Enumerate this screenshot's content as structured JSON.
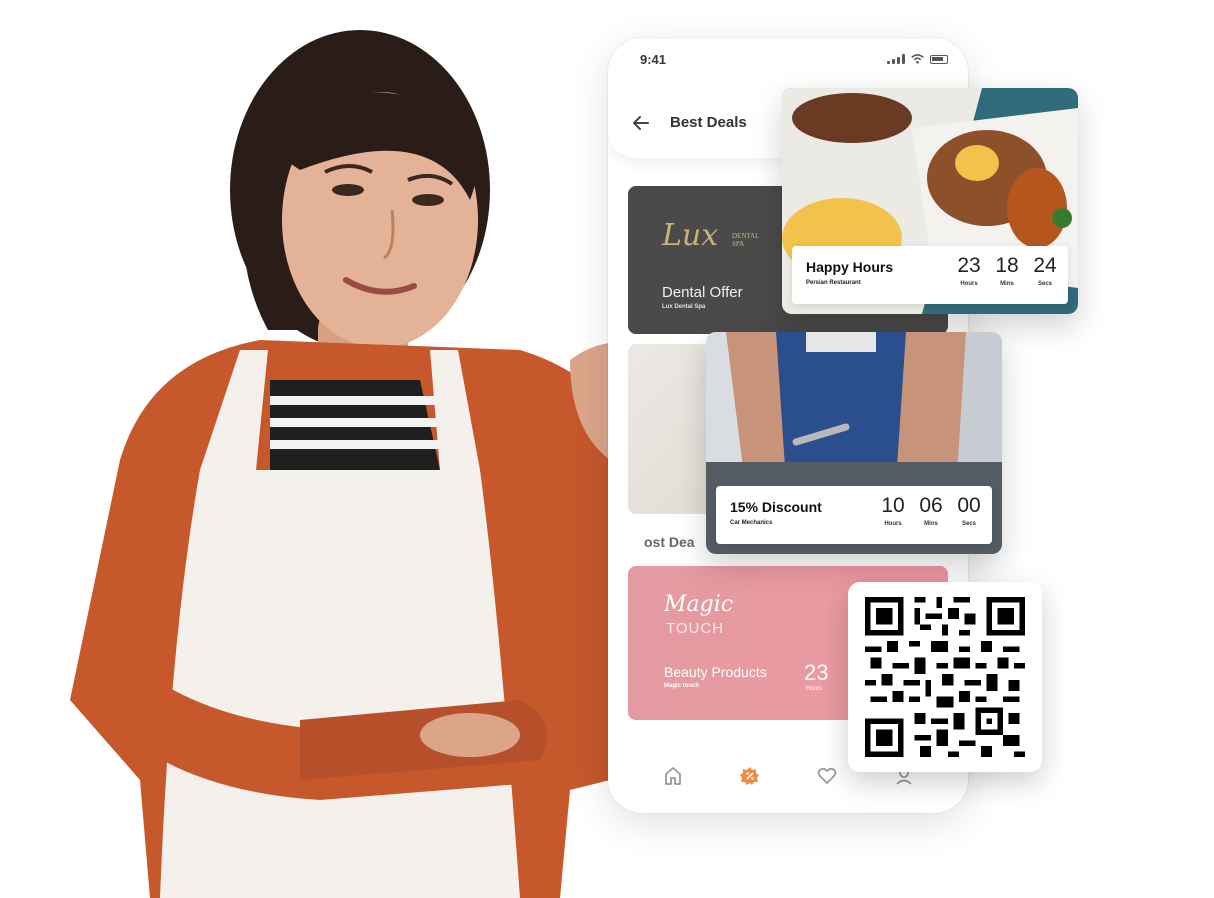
{
  "status_bar": {
    "time": "9:41"
  },
  "header": {
    "title": "Best Deals"
  },
  "dental_card": {
    "logo_script": "Lux",
    "logo_sub": "DENTAL SPA",
    "title": "Dental Offer",
    "subtitle": "Lux Dental Spa"
  },
  "section": {
    "label": "ost Dea"
  },
  "beauty_card": {
    "logo_script": "Magic",
    "logo_sub": "TOUCH",
    "title": "Beauty Products",
    "subtitle": "Magic touch",
    "hours": "23",
    "hours_label": "Hours"
  },
  "food_card": {
    "title": "Happy Hours",
    "subtitle": "Persian Restaurant",
    "timer": [
      {
        "value": "23",
        "label": "Hours"
      },
      {
        "value": "18",
        "label": "Mins"
      },
      {
        "value": "24",
        "label": "Secs"
      }
    ]
  },
  "mech_card": {
    "title": "15% Discount",
    "subtitle": "Car Mechanics",
    "timer": [
      {
        "value": "10",
        "label": "Hours"
      },
      {
        "value": "06",
        "label": "Mins"
      },
      {
        "value": "00",
        "label": "Secs"
      }
    ]
  },
  "bottom_nav": {
    "items": [
      "home-icon",
      "deals-icon",
      "heart-icon",
      "profile-icon"
    ],
    "active_color": "#f28c3c",
    "inactive_color": "#9a9a9a"
  },
  "colors": {
    "accent": "#f28c3c",
    "dental_bg": "#4a4a4a",
    "beauty_bg": "#e39aa0",
    "gold": "#c9b27a"
  }
}
